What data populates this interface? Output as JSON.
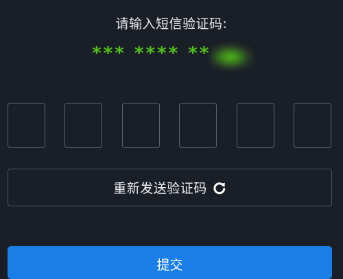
{
  "prompt": "请输入短信验证码:",
  "masked_phone": "*** **** **",
  "code_inputs": [
    {
      "value": ""
    },
    {
      "value": ""
    },
    {
      "value": ""
    },
    {
      "value": ""
    },
    {
      "value": ""
    },
    {
      "value": ""
    }
  ],
  "resend_button": {
    "label": "重新发送验证码",
    "icon": "refresh-icon"
  },
  "submit_button": {
    "label": "提交"
  },
  "colors": {
    "background": "#1a1e26",
    "masked_text": "#52c21a",
    "input_border": "#5c6170",
    "primary_button": "#1a7ee8"
  }
}
